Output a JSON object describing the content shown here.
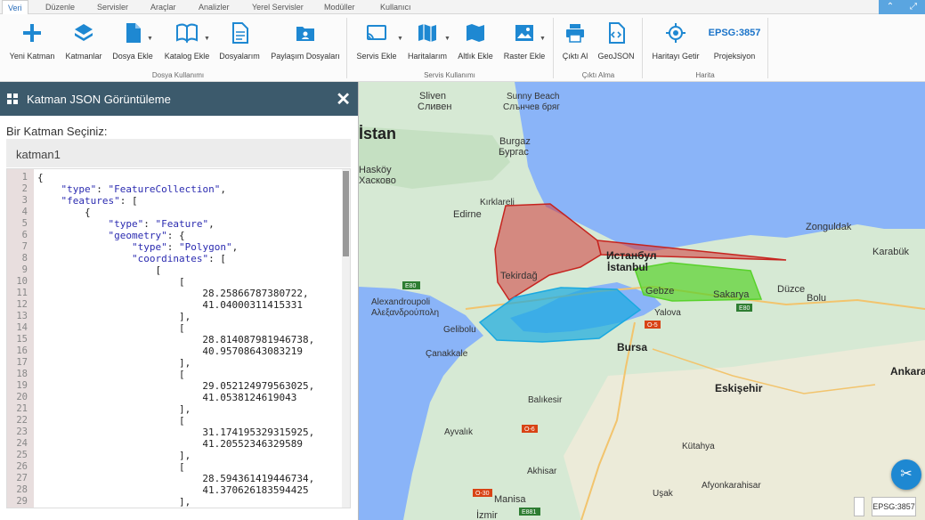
{
  "tabs": [
    {
      "label": "Veri",
      "active": true
    },
    {
      "label": "Düzenle"
    },
    {
      "label": "Servisler"
    },
    {
      "label": "Araçlar"
    },
    {
      "label": "Analizler"
    },
    {
      "label": "Yerel Servisler"
    },
    {
      "label": "Modüller"
    },
    {
      "label": "Kullanıcı"
    }
  ],
  "ribbon": {
    "buttons": [
      {
        "label": "Yeni Katman",
        "icon": "plus-icon"
      },
      {
        "label": "Katmanlar",
        "icon": "layers-icon"
      },
      {
        "label": "Dosya Ekle",
        "icon": "file-icon"
      },
      {
        "label": "Katalog Ekle",
        "icon": "book-icon"
      },
      {
        "label": "Dosyalarım",
        "icon": "document-icon"
      },
      {
        "label": "Paylaşım Dosyaları",
        "icon": "shared-folder-icon"
      },
      {
        "label": "Servis Ekle",
        "icon": "cast-icon"
      },
      {
        "label": "Haritalarım",
        "icon": "map-icon"
      },
      {
        "label": "Altlık Ekle",
        "icon": "basemap-icon"
      },
      {
        "label": "Raster Ekle",
        "icon": "image-icon"
      },
      {
        "label": "Çıktı Al",
        "icon": "printer-icon"
      },
      {
        "label": "GeoJSON",
        "icon": "code-file-icon"
      },
      {
        "label": "Haritayı Getir",
        "icon": "locate-icon"
      },
      {
        "label": "Projeksiyon",
        "epsg": "EPSG:3857"
      }
    ],
    "groups": [
      "Dosya Kullanımı",
      "Servis Kullanımı",
      "Çıktı Alma",
      "Harita"
    ]
  },
  "panel": {
    "title": "Katman JSON Görüntüleme",
    "prompt": "Bir Katman Seçiniz:",
    "selected_layer": "katman1",
    "code_lines": [
      "{",
      "    \"type\": \"FeatureCollection\",",
      "    \"features\": [",
      "        {",
      "            \"type\": \"Feature\",",
      "            \"geometry\": {",
      "                \"type\": \"Polygon\",",
      "                \"coordinates\": [",
      "                    [",
      "                        [",
      "                            28.25866787380722,",
      "                            41.04000311415331",
      "                        ],",
      "                        [",
      "                            28.814087981946738,",
      "                            40.95708643083219",
      "                        ],",
      "                        [",
      "                            29.052124979563025,",
      "                            41.0538124619043",
      "                        ],",
      "                        [",
      "                            31.174195329315925,",
      "                            41.20552346329589",
      "                        ],",
      "                        [",
      "                            28.594361419446734,",
      "                            41.370626183594425",
      "                        ],"
    ]
  },
  "map": {
    "labels": {
      "istan": "İstan",
      "sliven": "Sliven",
      "sliven_cyr": "Сливен",
      "sunny": "Sunny Beach",
      "sunny_cyr": "Слънчев бряг",
      "burgaz": "Burgaz",
      "burgaz_cyr": "Бургас",
      "haskoy": "Hasköy",
      "haskoy_cyr": "Хасково",
      "kirklareli": "Kırklareli",
      "edirne": "Edirne",
      "tekirdag": "Tekirdağ",
      "istanbul_cyr": "Истанбул",
      "istanbul": "İstanbul",
      "gebze": "Gebze",
      "sakarya": "Sakarya",
      "duzce": "Düzce",
      "bolu": "Bolu",
      "zonguldak": "Zonguldak",
      "karabuk": "Karabük",
      "alexandroupoli": "Alexandroupoli",
      "alexandroupoli_gr": "Αλεξανδρούπολη",
      "gelibolu": "Gelibolu",
      "yalova": "Yalova",
      "canakkale": "Çanakkale",
      "bursa": "Bursa",
      "eskisehir": "Eskişehir",
      "ankara": "Ankara",
      "balikesir": "Balıkesir",
      "kutahya": "Kütahya",
      "ayvalik": "Ayvalık",
      "akhisar": "Akhisar",
      "usak": "Uşak",
      "afyonkarahisar": "Afyonkarahisar",
      "manisa": "Manisa",
      "izmir": "İzmir",
      "o5": "O-5",
      "o6": "O-6",
      "o30": "O-30",
      "e80": "E80",
      "e881": "E881"
    },
    "layers": [
      {
        "name": "katman1",
        "color": "#d43a3a"
      },
      {
        "name": "blue-polygon",
        "color": "#1aa9e0"
      },
      {
        "name": "green-polygon",
        "color": "#59d22c"
      }
    ],
    "projection_badge": "EPSG:3857"
  },
  "colors": {
    "accent": "#1a73c9",
    "panel_header": "#3c5a6c",
    "sea": "#8ab4f8"
  }
}
